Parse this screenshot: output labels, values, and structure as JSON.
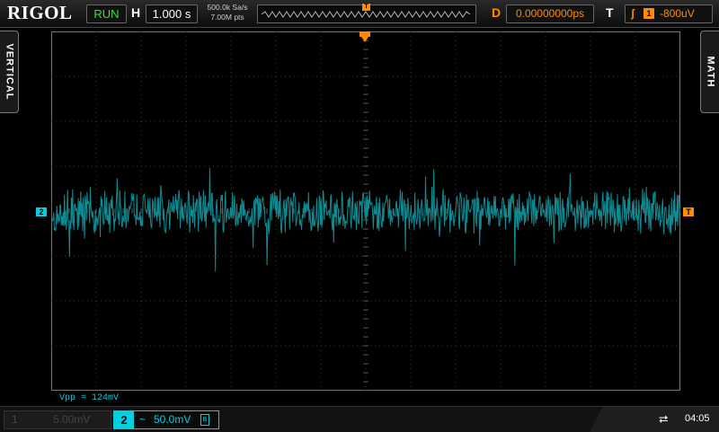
{
  "header": {
    "logo": "RIGOL",
    "run_status": "RUN",
    "horizontal_label": "H",
    "timebase": "1.000 s",
    "sample_rate": "500.0k Sa/s",
    "memory_depth": "7.00M pts",
    "delay_label": "D",
    "delay_value": "0.00000000ps",
    "trigger_label": "T",
    "trigger_edge": "rising-edge-icon",
    "trigger_source": "1",
    "trigger_level": "-800uV"
  },
  "side_tabs": {
    "left": "VERTICAL",
    "right": "MATH"
  },
  "markers": {
    "channel2": "2",
    "trigger_position": "T",
    "trigger_level": "T"
  },
  "measurement": {
    "vpp": "Vpp = 124mV"
  },
  "channels": {
    "ch1": {
      "number": "1",
      "scale": "5.00mV",
      "state": "off"
    },
    "ch2": {
      "number": "2",
      "coupling": "~",
      "scale": "50.0mV",
      "bw_limit": "B",
      "state": "on"
    }
  },
  "status": {
    "usb": "usb-icon",
    "time": "04:05"
  },
  "colors": {
    "ch2": "#00d0e0",
    "trace": "#0e8c94",
    "trigger": "#ff8c00",
    "run": "#3ddc3d",
    "grid": "#3a3a3a"
  }
}
